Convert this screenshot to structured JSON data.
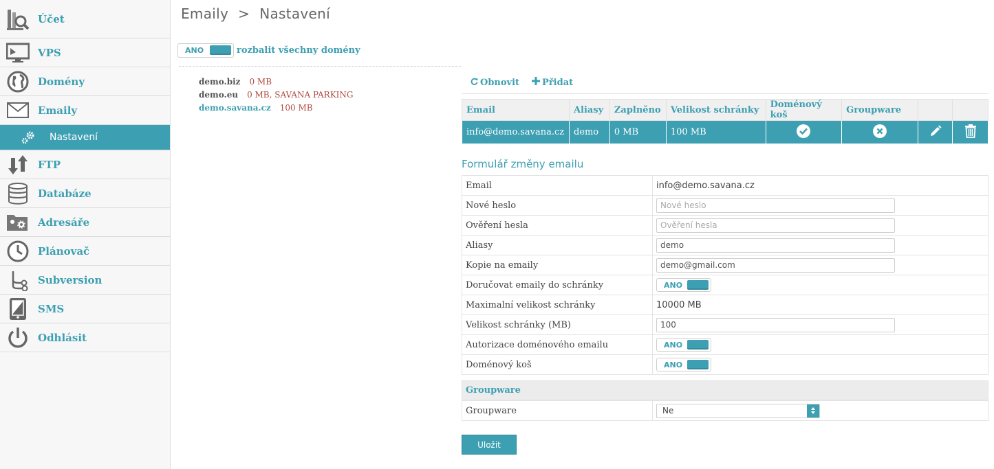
{
  "sidebar": {
    "items": [
      {
        "label": "Účet",
        "icon": "account-search-icon"
      },
      {
        "label": "VPS",
        "icon": "monitor-icon"
      },
      {
        "label": "Domény",
        "icon": "globe-icon"
      },
      {
        "label": "Emaily",
        "icon": "envelope-icon"
      },
      {
        "label": "Nastavení",
        "icon": "gears-icon"
      },
      {
        "label": "FTP",
        "icon": "up-down-arrows-icon"
      },
      {
        "label": "Databáze",
        "icon": "database-icon"
      },
      {
        "label": "Adresáře",
        "icon": "folder-gear-icon"
      },
      {
        "label": "Plánovač",
        "icon": "clock-icon"
      },
      {
        "label": "Subversion",
        "icon": "branch-icon"
      },
      {
        "label": "SMS",
        "icon": "phone-icon"
      },
      {
        "label": "Odhlásit",
        "icon": "power-icon"
      }
    ]
  },
  "breadcrumb": {
    "part1": "Emaily",
    "sep": ">",
    "part2": "Nastavení"
  },
  "expand": {
    "toggle_label": "ANO",
    "label": "rozbalit všechny domény"
  },
  "domains": [
    {
      "name": "demo.biz",
      "size": "0 MB"
    },
    {
      "name": "demo.eu",
      "size": "0 MB, SAVANA PARKING"
    },
    {
      "name": "demo.savana.cz",
      "size": "100 MB"
    }
  ],
  "actions": {
    "refresh": "Obnovit",
    "add": "Přidat"
  },
  "email_table": {
    "headers": [
      "Email",
      "Aliasy",
      "Zaplněno",
      "Velikost schránky",
      "Doménový koš",
      "Groupware"
    ],
    "row": {
      "email": "info@demo.savana.cz",
      "aliases": "demo",
      "used": "0 MB",
      "size": "100 MB"
    }
  },
  "form": {
    "title": "Formulář změny emailu",
    "email_label": "Email",
    "email_value": "info@demo.savana.cz",
    "new_password_label": "Nové heslo",
    "new_password_placeholder": "Nové heslo",
    "verify_password_label": "Ověření hesla",
    "verify_password_placeholder": "Ověření hesla",
    "aliases_label": "Aliasy",
    "aliases_value": "demo",
    "copy_label": "Kopie na emaily",
    "copy_value": "demo@gmail.com",
    "deliver_label": "Doručovat emaily do schránky",
    "deliver_toggle": "ANO",
    "max_size_label": "Maximalní velikost schránky",
    "max_size_value": "10000 MB",
    "box_size_label": "Velikost schránky (MB)",
    "box_size_value": "100",
    "auth_label": "Autorizace doménového emailu",
    "auth_toggle": "ANO",
    "trash_label": "Doménový koš",
    "trash_toggle": "ANO"
  },
  "groupware": {
    "section_title": "Groupware",
    "label": "Groupware",
    "selected": "Ne"
  },
  "save_label": "Uložit",
  "colors": {
    "accent": "#3d9fb2",
    "size_text": "#b04a3f"
  }
}
